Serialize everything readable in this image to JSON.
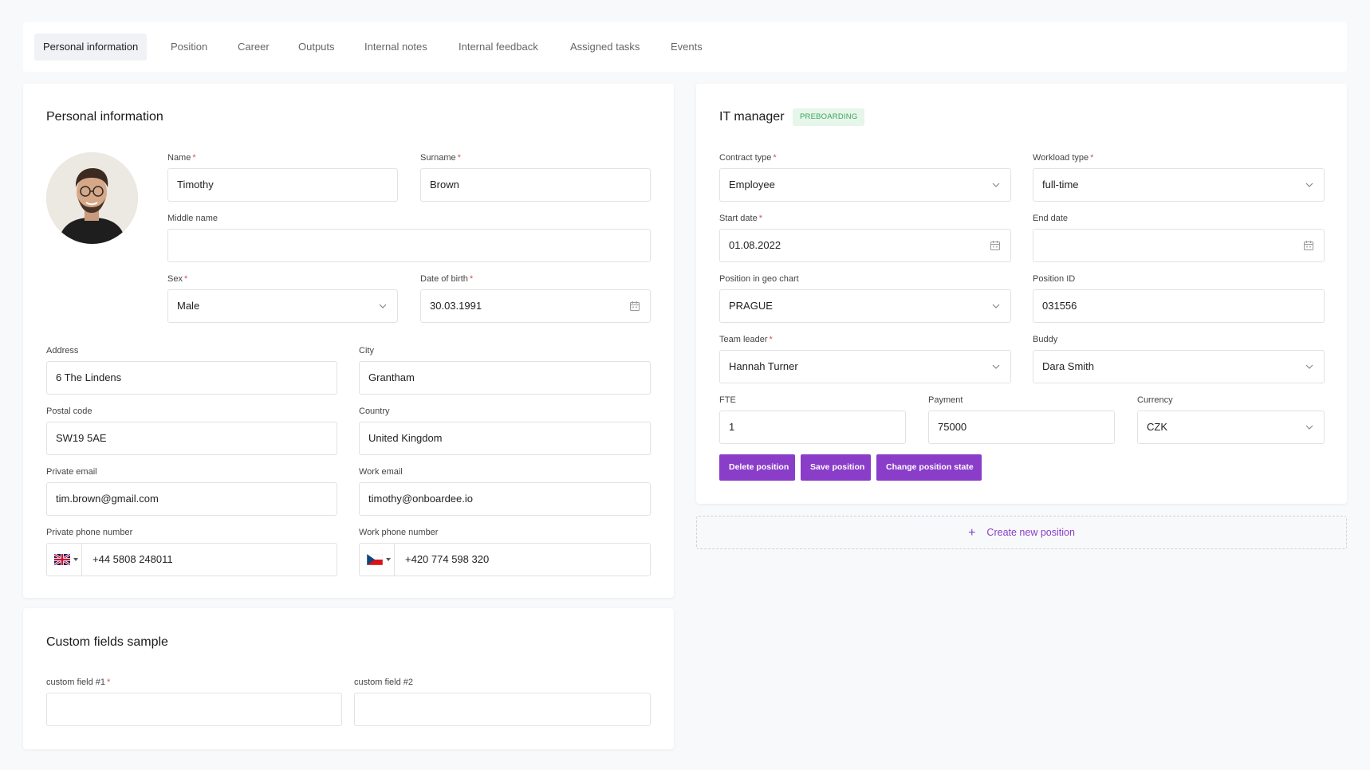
{
  "tabs": [
    {
      "label": "Personal information",
      "active": true
    },
    {
      "label": "Position",
      "active": false
    },
    {
      "label": "Career",
      "active": false
    },
    {
      "label": "Outputs",
      "active": false
    },
    {
      "label": "Internal notes",
      "active": false
    },
    {
      "label": "Internal feedback",
      "active": false
    },
    {
      "label": "Assigned tasks",
      "active": false
    },
    {
      "label": "Events",
      "active": false
    }
  ],
  "personal": {
    "title": "Personal information",
    "name": {
      "label": "Name",
      "value": "Timothy"
    },
    "surname": {
      "label": "Surname",
      "value": "Brown"
    },
    "middle_name": {
      "label": "Middle name",
      "value": ""
    },
    "sex": {
      "label": "Sex",
      "value": "Male"
    },
    "dob": {
      "label": "Date of birth",
      "value": "30.03.1991"
    },
    "address": {
      "label": "Address",
      "value": "6 The Lindens"
    },
    "city": {
      "label": "City",
      "value": "Grantham"
    },
    "postal": {
      "label": "Postal code",
      "value": "SW19 5AE"
    },
    "country": {
      "label": "Country",
      "value": "United Kingdom"
    },
    "private_email": {
      "label": "Private email",
      "value": "tim.brown@gmail.com"
    },
    "work_email": {
      "label": "Work email",
      "value": "timothy@onboardee.io"
    },
    "private_phone": {
      "label": "Private phone number",
      "value": "+44 5808 248011",
      "flag": "uk-flag-icon"
    },
    "work_phone": {
      "label": "Work phone number",
      "value": "+420 774 598 320",
      "flag": "cz-flag-icon"
    },
    "required_mark": "*"
  },
  "custom": {
    "title": "Custom fields sample",
    "field1": {
      "label": "custom field #1",
      "value": ""
    },
    "field2": {
      "label": "custom field #2",
      "value": ""
    }
  },
  "position": {
    "title": "IT manager",
    "badge": "PREBOARDING",
    "contract_type": {
      "label": "Contract type",
      "value": "Employee"
    },
    "workload_type": {
      "label": "Workload type",
      "value": "full-time"
    },
    "start_date": {
      "label": "Start date",
      "value": "01.08.2022"
    },
    "end_date": {
      "label": "End date",
      "value": ""
    },
    "geo": {
      "label": "Position in geo chart",
      "value": "PRAGUE"
    },
    "position_id": {
      "label": "Position ID",
      "value": "031556"
    },
    "team_leader": {
      "label": "Team leader",
      "value": "Hannah Turner"
    },
    "buddy": {
      "label": "Buddy",
      "value": "Dara Smith"
    },
    "fte": {
      "label": "FTE",
      "value": "1"
    },
    "payment": {
      "label": "Payment",
      "value": "75000"
    },
    "currency": {
      "label": "Currency",
      "value": "CZK"
    },
    "buttons": {
      "delete": "Delete position",
      "save": "Save position",
      "change": "Change position state"
    },
    "create_new": "Create new position"
  },
  "colors": {
    "accent": "#8a3dc9",
    "badge_text": "#3aa55b",
    "badge_bg": "#e6f6ea",
    "required": "#d9534f"
  }
}
